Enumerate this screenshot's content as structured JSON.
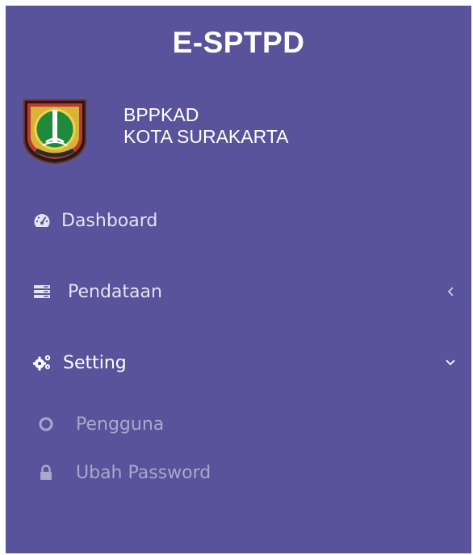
{
  "app": {
    "title": "E-SPTPD"
  },
  "org": {
    "line1": "BPPKAD",
    "line2": "KOTA SURAKARTA"
  },
  "menu": {
    "items": [
      {
        "label": "Dashboard",
        "icon": "dashboard-icon"
      },
      {
        "label": "Pendataan",
        "icon": "list-icon",
        "chevron": "chevron-left-icon"
      },
      {
        "label": "Setting",
        "icon": "gears-icon",
        "chevron": "chevron-down-icon",
        "active": true
      }
    ],
    "submenu": [
      {
        "label": "Pengguna",
        "icon": "circle-icon"
      },
      {
        "label": "Ubah Password",
        "icon": "lock-icon"
      }
    ]
  },
  "colors": {
    "sidebar_bg": "#58539a",
    "text": "#e6e4f2",
    "active_text": "#ffffff",
    "submenu_text": "#aaa8cc",
    "active_indicator": "#ffffff"
  }
}
